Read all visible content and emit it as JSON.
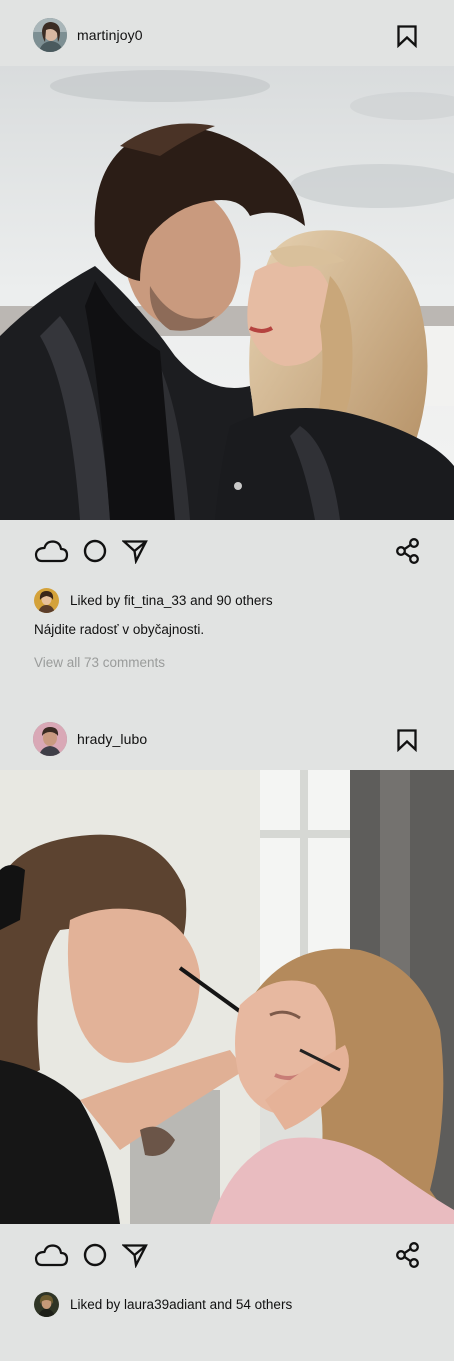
{
  "posts": [
    {
      "username": "martinjoy0",
      "liked_by_prefix": "Liked by ",
      "liked_by_user": "fit_tina_33",
      "liked_by_suffix": " and 90 others",
      "caption": "Nájdite radosť v obyčajnosti.",
      "view_comments": "View all 73 comments"
    },
    {
      "username": "hrady_lubo",
      "liked_by_prefix": "Liked by ",
      "liked_by_user": "laura39adiant",
      "liked_by_suffix": " and 54 others"
    }
  ],
  "icons": {
    "like": "cloud-icon",
    "comment": "circle-icon",
    "send": "send-arrow-icon",
    "share": "share-icon",
    "save": "bookmark-icon"
  },
  "colors": {
    "background": "#e1e3e2",
    "text": "#111111",
    "muted": "#9a9c9b"
  }
}
